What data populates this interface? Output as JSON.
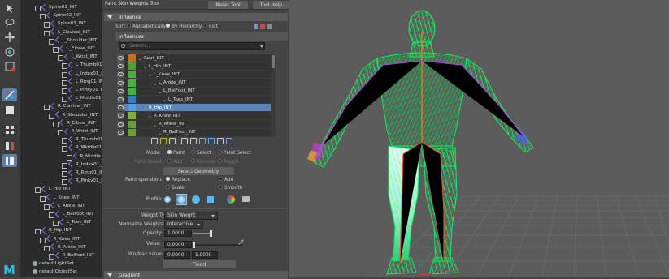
{
  "toolbar": {
    "tools": [
      {
        "icon": "select-arrow-icon",
        "active": false
      },
      {
        "icon": "lasso-icon",
        "active": false
      },
      {
        "icon": "move-icon",
        "active": false
      },
      {
        "icon": "rotate-icon",
        "active": false
      },
      {
        "icon": "scale-icon",
        "active": false
      },
      {
        "icon": "last-tool-icon",
        "active": true
      },
      {
        "icon": "single-pane-icon",
        "active": false
      },
      {
        "icon": "four-pane-icon",
        "active": false
      },
      {
        "icon": "two-pane-icon",
        "active": false
      },
      {
        "icon": "outliner-layout-icon",
        "active": true
      }
    ],
    "maya_logo": "M"
  },
  "outliner": {
    "items": [
      {
        "label": "Spine01_INT",
        "depth": 2,
        "type": "joint"
      },
      {
        "label": "Spine02_INT",
        "depth": 3,
        "type": "joint"
      },
      {
        "label": "Spine03_INT",
        "depth": 4,
        "type": "joint"
      },
      {
        "label": "L_Clavical_INT",
        "depth": 4,
        "type": "joint"
      },
      {
        "label": "L_Shoulder_INT",
        "depth": 5,
        "type": "joint"
      },
      {
        "label": "L_Elbow_INT",
        "depth": 6,
        "type": "joint"
      },
      {
        "label": "L_Wrist_INT",
        "depth": 7,
        "type": "joint"
      },
      {
        "label": "L_Thumb01_I",
        "depth": 8,
        "type": "joint"
      },
      {
        "label": "L_Index01_IN",
        "depth": 8,
        "type": "joint"
      },
      {
        "label": "L_Ring01_IN",
        "depth": 8,
        "type": "joint"
      },
      {
        "label": "L_Pinky01_IN",
        "depth": 8,
        "type": "joint"
      },
      {
        "label": "L_Middle01_I",
        "depth": 8,
        "type": "joint"
      },
      {
        "label": "R_Clavical_INT",
        "depth": 4,
        "type": "joint"
      },
      {
        "label": "R_Shoulder_INT",
        "depth": 5,
        "type": "joint"
      },
      {
        "label": "R_Elbow_INT",
        "depth": 6,
        "type": "joint"
      },
      {
        "label": "R_Wrist_INT",
        "depth": 7,
        "type": "joint"
      },
      {
        "label": "R_Thumb01_I",
        "depth": 8,
        "type": "joint"
      },
      {
        "label": "R_Middle01_I",
        "depth": 8,
        "type": "joint"
      },
      {
        "label": "R_Middle",
        "depth": 9,
        "type": "joint"
      },
      {
        "label": "R_Index01_I",
        "depth": 8,
        "type": "joint"
      },
      {
        "label": "R_Ring01_IN",
        "depth": 8,
        "type": "joint"
      },
      {
        "label": "R_Pinky01_IN",
        "depth": 8,
        "type": "joint"
      },
      {
        "label": "L_Hip_INT",
        "depth": 2,
        "type": "joint"
      },
      {
        "label": "L_Knee_INT",
        "depth": 3,
        "type": "joint"
      },
      {
        "label": "L_Ankle_INT",
        "depth": 4,
        "type": "joint"
      },
      {
        "label": "L_BalFoot_INT",
        "depth": 5,
        "type": "joint"
      },
      {
        "label": "L_Toes_INT",
        "depth": 6,
        "type": "joint"
      },
      {
        "label": "R_Hip_INT",
        "depth": 2,
        "type": "joint"
      },
      {
        "label": "R_Knee_INT",
        "depth": 3,
        "type": "joint"
      },
      {
        "label": "R_Ankle_INT",
        "depth": 4,
        "type": "joint"
      },
      {
        "label": "R_BalFoot_INT",
        "depth": 5,
        "type": "joint"
      },
      {
        "label": "defaultLightSet",
        "depth": 0,
        "type": "set"
      },
      {
        "label": "defaultObjectSet",
        "depth": 0,
        "type": "set"
      }
    ]
  },
  "panel": {
    "title": "Paint Skin Weights Tool",
    "reset_label": "Reset Tool",
    "help_label": "Tool Help",
    "influence_section": "Influence",
    "sort_label": "Sort:",
    "sort_options": [
      "Alphabetically",
      "By Hierarchy",
      "Flat"
    ],
    "sort_selected": "By Hierarchy",
    "influences_tab": "Influences",
    "search_placeholder": "Search...",
    "influences": [
      {
        "label": "Root_INT",
        "color": "#c07020",
        "indent": 0,
        "selected": false
      },
      {
        "label": "L_Hip_INT",
        "color": "#4aa030",
        "indent": 1,
        "selected": false
      },
      {
        "label": "L_Knee_INT",
        "color": "#48b040",
        "indent": 2,
        "selected": false
      },
      {
        "label": "L_Ankle_INT",
        "color": "#48b040",
        "indent": 3,
        "selected": false
      },
      {
        "label": "L_BalFoot_INT",
        "color": "#48b040",
        "indent": 4,
        "selected": false
      },
      {
        "label": "L_Toes_INT",
        "color": "#3080c8",
        "indent": 5,
        "selected": false
      },
      {
        "label": "R_Hip_INT",
        "color": "#5a9cd8",
        "indent": 1,
        "selected": true
      },
      {
        "label": "R_Knee_INT",
        "color": "#84b030",
        "indent": 2,
        "selected": false
      },
      {
        "label": "R_Ankle_INT",
        "color": "#6aa030",
        "indent": 3,
        "selected": false
      },
      {
        "label": "R_BalFoot_INT",
        "color": "#6aa030",
        "indent": 4,
        "selected": false
      }
    ],
    "mode_label": "Mode:",
    "mode_options": [
      "Paint",
      "Select",
      "Paint Select"
    ],
    "mode_selected": "Paint",
    "paint_select_label": "Paint Select:",
    "paint_select_options": [
      "Add",
      "Remove",
      "Toggle"
    ],
    "select_geometry_label": "Select Geometry",
    "paint_operation_label": "Paint operation:",
    "paint_ops": [
      "Replace",
      "Add",
      "Scale",
      "Smooth"
    ],
    "paint_op_selected": "Replace",
    "profile_label": "Profile:",
    "weight_type_label": "Weight Type:",
    "weight_type_value": "Skin Weight",
    "normalize_label": "Normalize Weights:",
    "normalize_value": "Interactive",
    "opacity_label": "Opacity:",
    "opacity_value": "1.0000",
    "value_label": "Value:",
    "value_value": "0.0000",
    "minmax_label": "Min/Max value:",
    "min_value": "0.0000",
    "max_value": "1.0000",
    "flood_label": "Flood",
    "gradient_section": "Gradient"
  },
  "viewport": {
    "background_color": "#5c5c5c",
    "mesh_color": "#18e85a",
    "painted_color": "#c8fff0"
  }
}
